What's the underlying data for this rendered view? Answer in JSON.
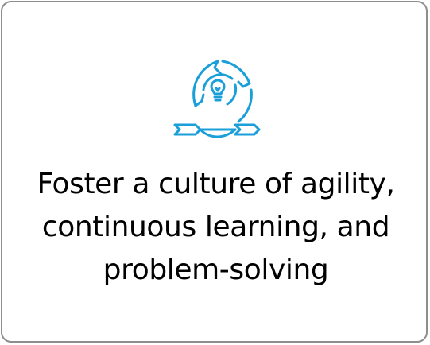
{
  "card": {
    "icon": "agility-cycle-lightbulb-icon",
    "accent_color": "#1a9fd8",
    "border_color": "#8e8e8e",
    "text_lines": [
      "Foster a culture of agility,",
      "continuous learning, and",
      "problem-solving"
    ]
  }
}
